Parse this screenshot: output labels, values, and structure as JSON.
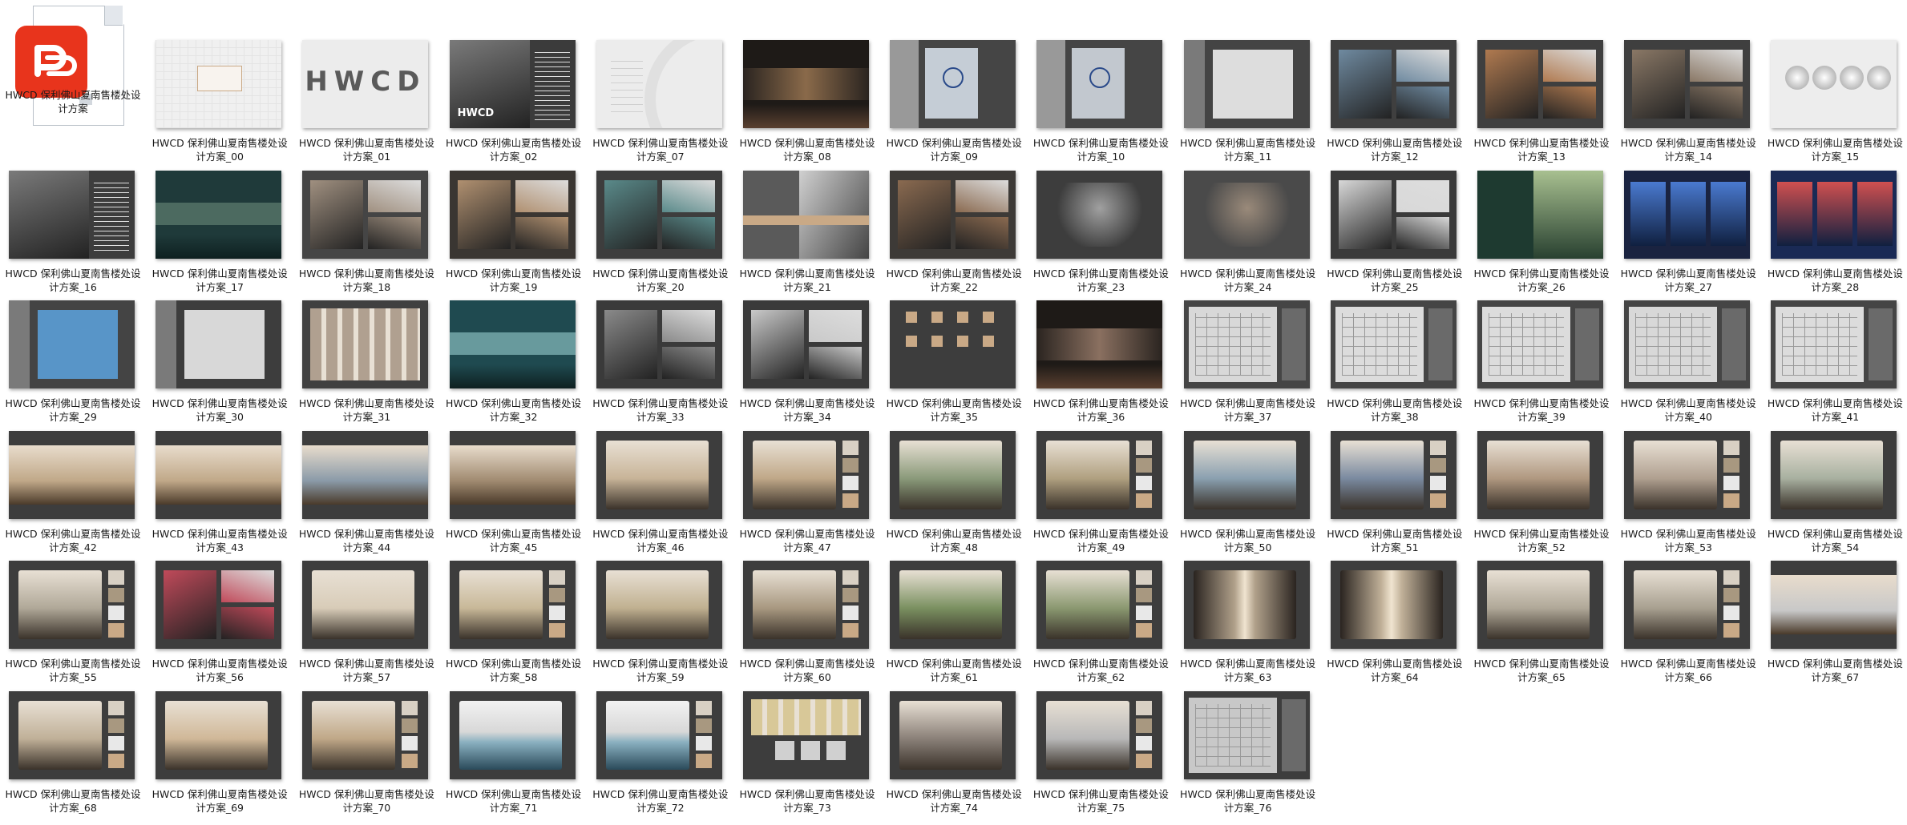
{
  "files": [
    {
      "name": "HWCD 保利佛山夏南售楼处设计方案",
      "kind": "pdf-icon"
    },
    {
      "name": "HWCD 保利佛山夏南售楼处设计方案_00",
      "thumb": {
        "bg": "#f0f0f0",
        "accent": "#c9a986",
        "style": "light-pattern"
      }
    },
    {
      "name": "HWCD 保利佛山夏南售楼处设计方案_01",
      "thumb": {
        "bg": "#ececec",
        "accent": "#5a5a5a",
        "style": "logo",
        "text": "HWCD"
      }
    },
    {
      "name": "HWCD 保利佛山夏南售楼处设计方案_02",
      "thumb": {
        "bg": "#3b3b3b",
        "accent": "#9a9a9a",
        "style": "photo-left",
        "text": "HWCD"
      }
    },
    {
      "name": "HWCD 保利佛山夏南售楼处设计方案_07",
      "thumb": {
        "bg": "#ececec",
        "accent": "#cfcfcf",
        "style": "light-curves"
      }
    },
    {
      "name": "HWCD 保利佛山夏南售楼处设计方案_08",
      "thumb": {
        "bg": "#1e1a17",
        "accent": "#8a6a4a",
        "style": "wave"
      }
    },
    {
      "name": "HWCD 保利佛山夏南售楼处设计方案_09",
      "thumb": {
        "bg": "#454545",
        "accent": "#c5cdd6",
        "style": "map"
      }
    },
    {
      "name": "HWCD 保利佛山夏南售楼处设计方案_10",
      "thumb": {
        "bg": "#454545",
        "accent": "#c2c8cf",
        "style": "map2"
      }
    },
    {
      "name": "HWCD 保利佛山夏南售楼处设计方案_11",
      "thumb": {
        "bg": "#444444",
        "accent": "#e6e6e6",
        "style": "diagram"
      }
    },
    {
      "name": "HWCD 保利佛山夏南售楼处设计方案_12",
      "thumb": {
        "bg": "#3f3f3f",
        "accent": "#6f8aa0",
        "style": "city"
      }
    },
    {
      "name": "HWCD 保利佛山夏南售楼处设计方案_13",
      "thumb": {
        "bg": "#3f3f3f",
        "accent": "#b07a50",
        "style": "photos"
      }
    },
    {
      "name": "HWCD 保利佛山夏南售楼处设计方案_14",
      "thumb": {
        "bg": "#3f3f3f",
        "accent": "#8a7866",
        "style": "photos"
      }
    },
    {
      "name": "HWCD 保利佛山夏南售楼处设计方案_15",
      "thumb": {
        "bg": "#ededed",
        "accent": "#9a9a9a",
        "style": "circles"
      }
    },
    {
      "name": "HWCD 保利佛山夏南售楼处设计方案_16",
      "thumb": {
        "bg": "#3d3d3d",
        "accent": "#8a8f86",
        "style": "photo-left"
      }
    },
    {
      "name": "HWCD 保利佛山夏南售楼处设计方案_17",
      "thumb": {
        "bg": "#1f3a3a",
        "accent": "#6a8a7a",
        "style": "teal-band"
      }
    },
    {
      "name": "HWCD 保利佛山夏南售楼处设计方案_18",
      "thumb": {
        "bg": "#454545",
        "accent": "#a09080",
        "style": "photos"
      }
    },
    {
      "name": "HWCD 保利佛山夏南售楼处设计方案_19",
      "thumb": {
        "bg": "#3a3632",
        "accent": "#b09070",
        "style": "photos"
      }
    },
    {
      "name": "HWCD 保利佛山夏南售楼处设计方案_20",
      "thumb": {
        "bg": "#3d3d3d",
        "accent": "#5a8a8a",
        "style": "photos"
      }
    },
    {
      "name": "HWCD 保利佛山夏南售楼处设计方案_21",
      "thumb": {
        "bg": "#5a5a5a",
        "accent": "#c9a986",
        "style": "portrait"
      }
    },
    {
      "name": "HWCD 保利佛山夏南售楼处设计方案_22",
      "thumb": {
        "bg": "#3d3a37",
        "accent": "#8a6a50",
        "style": "photos"
      }
    },
    {
      "name": "HWCD 保利佛山夏南售楼处设计方案_23",
      "thumb": {
        "bg": "#3d3d3d",
        "accent": "#a0a0a0",
        "style": "smoke"
      }
    },
    {
      "name": "HWCD 保利佛山夏南售楼处设计方案_24",
      "thumb": {
        "bg": "#4a4a4a",
        "accent": "#9a8a7a",
        "style": "room"
      }
    },
    {
      "name": "HWCD 保利佛山夏南售楼处设计方案_25",
      "thumb": {
        "bg": "#3a3a3a",
        "accent": "#d8d8d8",
        "style": "photos"
      }
    },
    {
      "name": "HWCD 保利佛山夏南售楼处设计方案_26",
      "thumb": {
        "bg": "#1e3a30",
        "accent": "#9ab38a",
        "style": "forest"
      }
    },
    {
      "name": "HWCD 保利佛山夏南售楼处设计方案_27",
      "thumb": {
        "bg": "#1a2340",
        "accent": "#4a7ad0",
        "style": "blue"
      }
    },
    {
      "name": "HWCD 保利佛山夏南售楼处设计方案_28",
      "thumb": {
        "bg": "#1a2a55",
        "accent": "#d05050",
        "style": "blue"
      }
    },
    {
      "name": "HWCD 保利佛山夏南售楼处设计方案_29",
      "thumb": {
        "bg": "#444444",
        "accent": "#5a9ad0",
        "style": "diagram"
      }
    },
    {
      "name": "HWCD 保利佛山夏南售楼处设计方案_30",
      "thumb": {
        "bg": "#3d3d3d",
        "accent": "#e0e0e0",
        "style": "diagram"
      }
    },
    {
      "name": "HWCD 保利佛山夏南售楼处设计方案_31",
      "thumb": {
        "bg": "#404040",
        "accent": "#b0a090",
        "style": "stripes"
      }
    },
    {
      "name": "HWCD 保利佛山夏南售楼处设计方案_32",
      "thumb": {
        "bg": "#1f4a50",
        "accent": "#9ad0d0",
        "style": "teal-band"
      }
    },
    {
      "name": "HWCD 保利佛山夏南售楼处设计方案_33",
      "thumb": {
        "bg": "#3a3a3a",
        "accent": "#8a8a8a",
        "style": "photos"
      }
    },
    {
      "name": "HWCD 保利佛山夏南售楼处设计方案_34",
      "thumb": {
        "bg": "#3a3a3a",
        "accent": "#c9c9c9",
        "style": "photos"
      }
    },
    {
      "name": "HWCD 保利佛山夏南售楼处设计方案_35",
      "thumb": {
        "bg": "#3d3d3d",
        "accent": "#c9a986",
        "style": "dots"
      }
    },
    {
      "name": "HWCD 保利佛山夏南售楼处设计方案_36",
      "thumb": {
        "bg": "#1e1a17",
        "accent": "#8a7060",
        "style": "wave"
      }
    },
    {
      "name": "HWCD 保利佛山夏南售楼处设计方案_37",
      "thumb": {
        "bg": "#454545",
        "accent": "#d8d8d8",
        "style": "plan"
      }
    },
    {
      "name": "HWCD 保利佛山夏南售楼处设计方案_38",
      "thumb": {
        "bg": "#454545",
        "accent": "#dcdcdc",
        "style": "plan"
      }
    },
    {
      "name": "HWCD 保利佛山夏南售楼处设计方案_39",
      "thumb": {
        "bg": "#454545",
        "accent": "#dcdcdc",
        "style": "plan"
      }
    },
    {
      "name": "HWCD 保利佛山夏南售楼处设计方案_40",
      "thumb": {
        "bg": "#454545",
        "accent": "#d8d8d8",
        "style": "plan"
      }
    },
    {
      "name": "HWCD 保利佛山夏南售楼处设计方案_41",
      "thumb": {
        "bg": "#454545",
        "accent": "#dcdcdc",
        "style": "plan"
      }
    },
    {
      "name": "HWCD 保利佛山夏南售楼处设计方案_42",
      "thumb": {
        "bg": "#3d3d3d",
        "accent": "#c0a888",
        "style": "render-wide"
      }
    },
    {
      "name": "HWCD 保利佛山夏南售楼处设计方案_43",
      "thumb": {
        "bg": "#3d3d3d",
        "accent": "#c0a888",
        "style": "render-wide"
      }
    },
    {
      "name": "HWCD 保利佛山夏南售楼处设计方案_44",
      "thumb": {
        "bg": "#3d3d3d",
        "accent": "#8a9aa8",
        "style": "render-wide"
      }
    },
    {
      "name": "HWCD 保利佛山夏南售楼处设计方案_45",
      "thumb": {
        "bg": "#3d3d3d",
        "accent": "#a08a70",
        "style": "render-wide"
      }
    },
    {
      "name": "HWCD 保利佛山夏南售楼处设计方案_46",
      "thumb": {
        "bg": "#3d3d3d",
        "accent": "#c8b498",
        "style": "render"
      }
    },
    {
      "name": "HWCD 保利佛山夏南售楼处设计方案_47",
      "thumb": {
        "bg": "#3d3d3d",
        "accent": "#c0a888",
        "style": "render-swatch"
      }
    },
    {
      "name": "HWCD 保利佛山夏南售楼处设计方案_48",
      "thumb": {
        "bg": "#3d3d3d",
        "accent": "#8a9a7a",
        "style": "render"
      }
    },
    {
      "name": "HWCD 保利佛山夏南售楼处设计方案_49",
      "thumb": {
        "bg": "#3d3d3d",
        "accent": "#b0a080",
        "style": "render-swatch"
      }
    },
    {
      "name": "HWCD 保利佛山夏南售楼处设计方案_50",
      "thumb": {
        "bg": "#3d3d3d",
        "accent": "#8aa0b0",
        "style": "render"
      }
    },
    {
      "name": "HWCD 保利佛山夏南售楼处设计方案_51",
      "thumb": {
        "bg": "#3d3d3d",
        "accent": "#7a8aa0",
        "style": "render-swatch"
      }
    },
    {
      "name": "HWCD 保利佛山夏南售楼处设计方案_52",
      "thumb": {
        "bg": "#3d3d3d",
        "accent": "#b09880",
        "style": "render"
      }
    },
    {
      "name": "HWCD 保利佛山夏南售楼处设计方案_53",
      "thumb": {
        "bg": "#3d3d3d",
        "accent": "#b0a090",
        "style": "render-swatch"
      }
    },
    {
      "name": "HWCD 保利佛山夏南售楼处设计方案_54",
      "thumb": {
        "bg": "#3d3d3d",
        "accent": "#a8b0a0",
        "style": "render"
      }
    },
    {
      "name": "HWCD 保利佛山夏南售楼处设计方案_55",
      "thumb": {
        "bg": "#3d3d3d",
        "accent": "#b0a898",
        "style": "render-swatch"
      }
    },
    {
      "name": "HWCD 保利佛山夏南售楼处设计方案_56",
      "thumb": {
        "bg": "#3d3d3d",
        "accent": "#c04a5a",
        "style": "photos"
      }
    },
    {
      "name": "HWCD 保利佛山夏南售楼处设计方案_57",
      "thumb": {
        "bg": "#3d3d3d",
        "accent": "#d8ccb8",
        "style": "render"
      }
    },
    {
      "name": "HWCD 保利佛山夏南售楼处设计方案_58",
      "thumb": {
        "bg": "#3d3d3d",
        "accent": "#c8b898",
        "style": "render-swatch"
      }
    },
    {
      "name": "HWCD 保利佛山夏南售楼处设计方案_59",
      "thumb": {
        "bg": "#3d3d3d",
        "accent": "#c0b090",
        "style": "render"
      }
    },
    {
      "name": "HWCD 保利佛山夏南售楼处设计方案_60",
      "thumb": {
        "bg": "#3d3d3d",
        "accent": "#a89880",
        "style": "render-swatch"
      }
    },
    {
      "name": "HWCD 保利佛山夏南售楼处设计方案_61",
      "thumb": {
        "bg": "#3d3d3d",
        "accent": "#7a9060",
        "style": "render"
      }
    },
    {
      "name": "HWCD 保利佛山夏南售楼处设计方案_62",
      "thumb": {
        "bg": "#3d3d3d",
        "accent": "#8a9870",
        "style": "render-swatch"
      }
    },
    {
      "name": "HWCD 保利佛山夏南售楼处设计方案_63",
      "thumb": {
        "bg": "#3d3d3d",
        "accent": "#b0a08a",
        "style": "corridor"
      }
    },
    {
      "name": "HWCD 保利佛山夏南售楼处设计方案_64",
      "thumb": {
        "bg": "#3d3d3d",
        "accent": "#c0b098",
        "style": "corridor"
      }
    },
    {
      "name": "HWCD 保利佛山夏南售楼处设计方案_65",
      "thumb": {
        "bg": "#3d3d3d",
        "accent": "#b0a898",
        "style": "render"
      }
    },
    {
      "name": "HWCD 保利佛山夏南售楼处设计方案_66",
      "thumb": {
        "bg": "#3d3d3d",
        "accent": "#a8a090",
        "style": "render-swatch"
      }
    },
    {
      "name": "HWCD 保利佛山夏南售楼处设计方案_67",
      "thumb": {
        "bg": "#3d3d3d",
        "accent": "#c8c8c8",
        "style": "render-wide"
      }
    },
    {
      "name": "HWCD 保利佛山夏南售楼处设计方案_68",
      "thumb": {
        "bg": "#3d3d3d",
        "accent": "#c0b098",
        "style": "render-swatch"
      }
    },
    {
      "name": "HWCD 保利佛山夏南售楼处设计方案_69",
      "thumb": {
        "bg": "#3d3d3d",
        "accent": "#d0b898",
        "style": "render"
      }
    },
    {
      "name": "HWCD 保利佛山夏南售楼处设计方案_70",
      "thumb": {
        "bg": "#3d3d3d",
        "accent": "#c0a888",
        "style": "render-swatch"
      }
    },
    {
      "name": "HWCD 保利佛山夏南售楼处设计方案_71",
      "thumb": {
        "bg": "#3d3d3d",
        "accent": "#8ab0c0",
        "style": "pool"
      }
    },
    {
      "name": "HWCD 保利佛山夏南售楼处设计方案_72",
      "thumb": {
        "bg": "#3d3d3d",
        "accent": "#8ab0c0",
        "style": "pool-swatch"
      }
    },
    {
      "name": "HWCD 保利佛山夏南售楼处设计方案_73",
      "thumb": {
        "bg": "#3d3d3d",
        "accent": "#d8c898",
        "style": "stripes-light"
      }
    },
    {
      "name": "HWCD 保利佛山夏南售楼处设计方案_74",
      "thumb": {
        "bg": "#3d3d3d",
        "accent": "#8a8078",
        "style": "render"
      }
    },
    {
      "name": "HWCD 保利佛山夏南售楼处设计方案_75",
      "thumb": {
        "bg": "#3d3d3d",
        "accent": "#b8b8b8",
        "style": "render-swatch"
      }
    },
    {
      "name": "HWCD 保利佛山夏南售楼处设计方案_76",
      "thumb": {
        "bg": "#3d3d3d",
        "accent": "#c8c8c8",
        "style": "plan"
      }
    }
  ],
  "colors": {
    "pdf_red": "#e8341c",
    "label_text": "#1a1a1a"
  }
}
